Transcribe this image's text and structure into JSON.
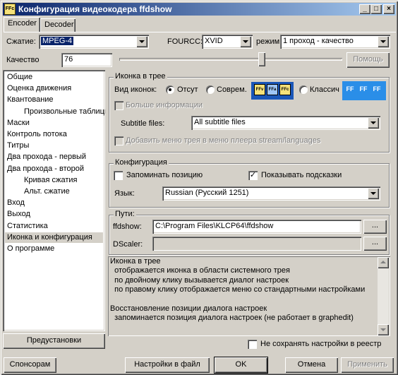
{
  "window": {
    "title": "Конфигурация видеокодера ffdshow",
    "icon_text": "FFc",
    "controls": {
      "minimize": "_",
      "maximize": "□",
      "close": "×"
    }
  },
  "tabs": [
    {
      "label": "Encoder",
      "active": true
    },
    {
      "label": "Decoder",
      "active": false
    }
  ],
  "top": {
    "compression_label": "Сжатие:",
    "compression_value": "MPEG-4",
    "fourcc_label": "FOURCC:",
    "fourcc_value": "XVID",
    "mode_label": "режим",
    "mode_value": "1 проход - качество",
    "quality_label": "Качество",
    "quality_value": "76",
    "quality_slider_fraction": 0.64,
    "help_button": "Помощь"
  },
  "sidebar": {
    "items": [
      {
        "label": "Общие",
        "indent": 0
      },
      {
        "label": "Оценка движения",
        "indent": 0
      },
      {
        "label": "Квантование",
        "indent": 0
      },
      {
        "label": "Произвольные таблицы",
        "indent": 1
      },
      {
        "label": "Маски",
        "indent": 0
      },
      {
        "label": "Контроль потока",
        "indent": 0
      },
      {
        "label": "Титры",
        "indent": 0
      },
      {
        "label": "Два прохода - первый",
        "indent": 0
      },
      {
        "label": "Два прохода - второй",
        "indent": 0
      },
      {
        "label": "Кривая сжатия",
        "indent": 1
      },
      {
        "label": "Альт. сжатие",
        "indent": 1
      },
      {
        "label": "Вход",
        "indent": 0
      },
      {
        "label": "Выход",
        "indent": 0
      },
      {
        "label": "Статистика",
        "indent": 0
      },
      {
        "label": "Иконка и конфигурация",
        "indent": 0,
        "selected": true
      },
      {
        "label": "О программе",
        "indent": 0
      }
    ],
    "presets_button": "Предустановки"
  },
  "tray_group": {
    "legend": "Иконка в трее",
    "icon_view_label": "Вид иконок:",
    "options": [
      {
        "label": "Отсут",
        "checked": true
      },
      {
        "label": "Соврем.",
        "checked": false
      },
      {
        "label": "Классич",
        "checked": false
      }
    ],
    "modern_icons": [
      "FFv",
      "FFa",
      "FFc"
    ],
    "classic_icons": [
      "FF",
      "FF",
      "FF"
    ],
    "more_info_label": "Больше информации",
    "subtitle_files_label": "Subtitle files:",
    "subtitle_files_value": "All subtitle files",
    "add_menu_label": "Добавить меню трея в меню плеера stream/languages"
  },
  "config_group": {
    "legend": "Конфигурация",
    "remember_position_label": "Запоминать позицию",
    "remember_position_checked": false,
    "show_hints_label": "Показывать подсказки",
    "show_hints_checked": true,
    "language_label": "Язык:",
    "language_value": "Russian (Русский 1251)"
  },
  "paths_group": {
    "legend": "Пути:",
    "ffdshow_label": "ffdshow:",
    "ffdshow_value": "C:\\Program Files\\KLCP64\\ffdshow",
    "browse_label": "...",
    "dscaler_label": "DScaler:",
    "dscaler_value": ""
  },
  "description_lines": [
    "Иконка в трее",
    "  отображается иконка в области системного трея",
    "  по двойному клику вызывается диалог настроек",
    "  по правому клику отображается меню со стандартными настройками",
    "",
    "Восстановление позиции диалога настроек",
    "  запоминается позиция диалога настроек (не работает в graphedit)"
  ],
  "dont_save_label": "Не сохранять настройки в реестр",
  "bottom_buttons": {
    "sponsors": "Спонсорам",
    "save_to_file": "Настройки в файл",
    "ok": "OK",
    "cancel": "Отмена",
    "apply": "Применить"
  }
}
